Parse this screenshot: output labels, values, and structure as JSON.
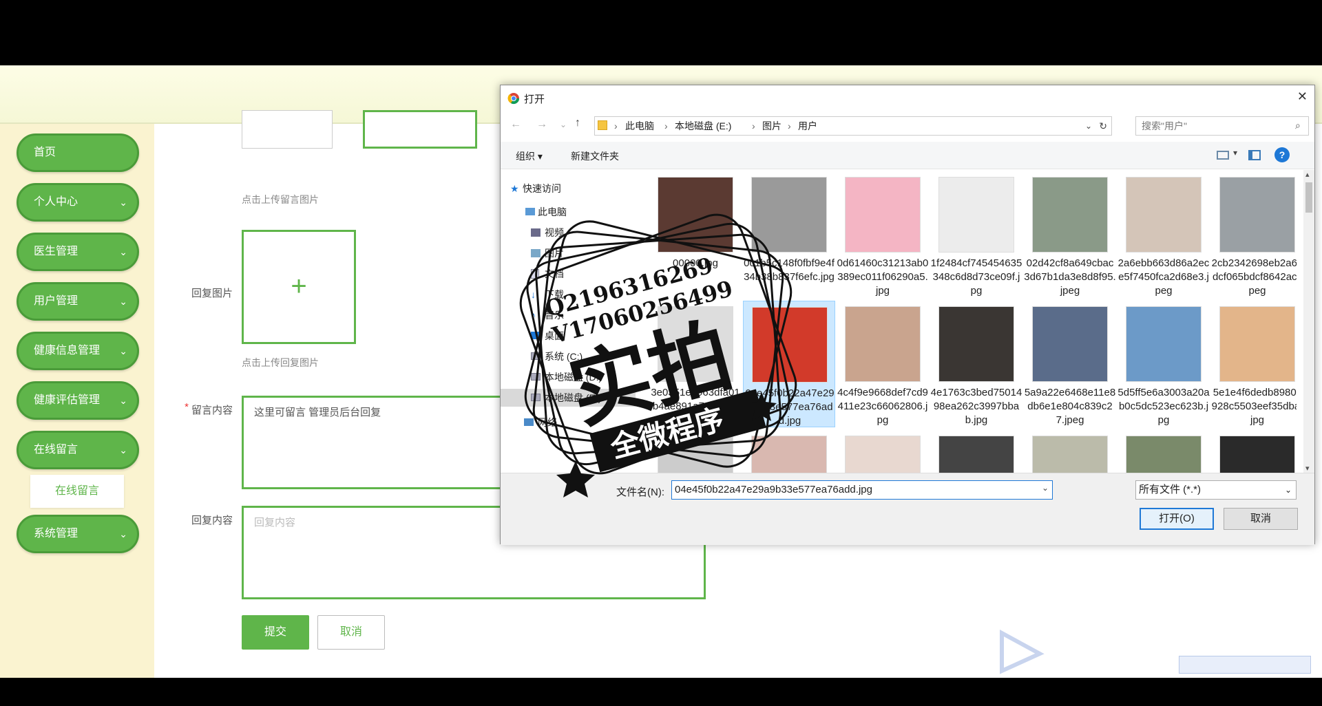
{
  "sidebar": {
    "items": [
      {
        "label": "首页",
        "expandable": false
      },
      {
        "label": "个人中心",
        "expandable": true
      },
      {
        "label": "医生管理",
        "expandable": true
      },
      {
        "label": "用户管理",
        "expandable": true
      },
      {
        "label": "健康信息管理",
        "expandable": true
      },
      {
        "label": "健康评估管理",
        "expandable": true
      },
      {
        "label": "在线留言",
        "expandable": true
      },
      {
        "label": "系统管理",
        "expandable": true
      }
    ],
    "sub_item": "在线留言"
  },
  "form": {
    "hint_message_image": "点击上传留言图片",
    "reply_image_label": "回复图片",
    "hint_reply_image": "点击上传回复图片",
    "required_mark": "*",
    "message_label": "留言内容",
    "message_value": "这里可留言  管理员后台回复",
    "reply_label": "回复内容",
    "reply_placeholder": "回复内容",
    "submit_label": "提交",
    "cancel_label": "取消",
    "plus": "+"
  },
  "dialog": {
    "title": "打开",
    "close": "✕",
    "path": [
      "此电脑",
      "本地磁盘 (E:)",
      "图片",
      "用户"
    ],
    "search_placeholder": "搜索\"用户\"",
    "organize": "组织 ▾",
    "new_folder": "新建文件夹",
    "tree": [
      "快速访问",
      "此电脑",
      "视频",
      "图片",
      "文档",
      "下载",
      "音乐",
      "桌面",
      "系统 (C:)",
      "本地磁盘 (D:)",
      "本地磁盘 (E:)",
      "网络"
    ],
    "files": [
      {
        "name": "00000.jpg",
        "color": "#5b3a32"
      },
      {
        "name": "0c1b5c148f0fbf9e4f34b38b837f6efc.jpg",
        "color": "#9a9a9a"
      },
      {
        "name": "0d61460c31213ab0389ec011f06290a5.jpg",
        "color": "#f4b5c4"
      },
      {
        "name": "1f2484cf745454635348c6d8d73ce09f.jpg",
        "color": "#ececec"
      },
      {
        "name": "02d42cf8a649cbac3d67b1da3e8d8f95.jpeg",
        "color": "#8a9a88"
      },
      {
        "name": "2a6ebb663d86a2ece5f7450fca2d68e3.jpeg",
        "color": "#d4c5b8"
      },
      {
        "name": "2cb2342698eb2a63dcf065bdcf8642ac.jpeg",
        "color": "#9aa0a4"
      },
      {
        "name": "3e0351ee963dfa01b4ae891a7c60186a.jpg",
        "color": "#ddd"
      },
      {
        "name": "04e45f0b22a47e29a9b33e577ea76add.jpg",
        "color": "#d23a2a"
      },
      {
        "name": "4c4f9e9668def7cd9411e23c66062806.jpg",
        "color": "#c9a48e"
      },
      {
        "name": "4e1763c3bed7501498ea262c3997bbab.jpg",
        "color": "#3a3633"
      },
      {
        "name": "5a9a22e6468e11e8db6e1e804c839c27.jpeg",
        "color": "#5a6c8a"
      },
      {
        "name": "5d5ff5e6a3003a20ab0c5dc523ec623b.jpg",
        "color": "#6c9ac8"
      },
      {
        "name": "5e1e4f6dedb8980c928c5503eef35dba.jpg",
        "color": "#e3b58a"
      },
      {
        "name": "",
        "color": "#ccc"
      },
      {
        "name": "",
        "color": "#d9b8b0"
      },
      {
        "name": "",
        "color": "#e8d8d0"
      },
      {
        "name": "",
        "color": "#444"
      },
      {
        "name": "",
        "color": "#bba"
      },
      {
        "name": "",
        "color": "#7a8a6a"
      },
      {
        "name": "",
        "color": "#2a2a2a"
      }
    ],
    "filename_label": "文件名(N):",
    "filename_value": "04e45f0b22a47e29a9b33e577ea76add.jpg",
    "filter_value": "所有文件 (*.*)",
    "open_label": "打开(O)",
    "cancel_label": "取消"
  },
  "watermark": {
    "line1": "Q2196316269",
    "line2": "V17060256499",
    "big": "实拍",
    "banner": "全微程序"
  },
  "colors": {
    "accent": "#5fb54a",
    "sidebar_bg": "#faf3d0"
  }
}
